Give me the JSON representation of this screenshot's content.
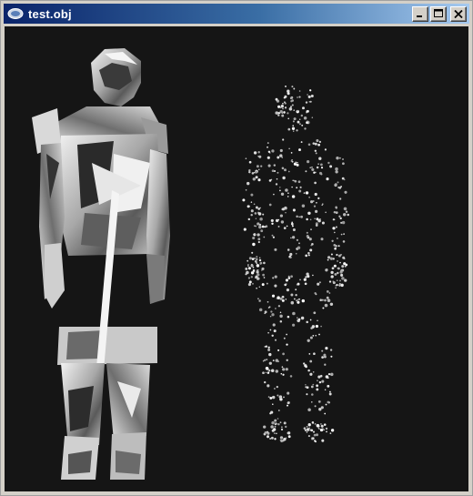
{
  "window": {
    "title": "test.obj",
    "icon": "app-window-icon",
    "controls": [
      "minimize-icon",
      "maximize-icon",
      "close-icon"
    ]
  },
  "viewport": {
    "background": "#151515",
    "solid_model_color": "#bdbdbd",
    "point_cloud_color": "#e0e0e0"
  }
}
